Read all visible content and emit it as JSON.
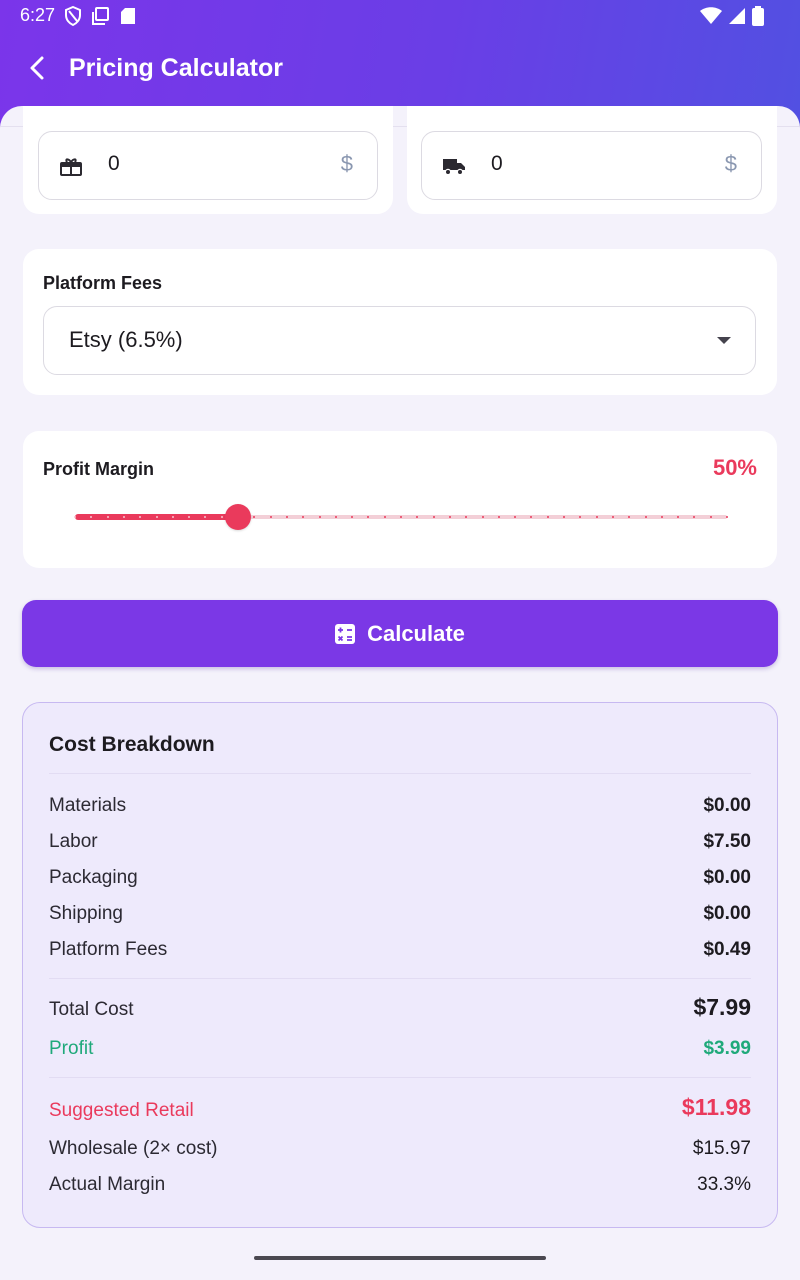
{
  "status_bar": {
    "time": "6:27"
  },
  "app_bar": {
    "title": "Pricing Calculator"
  },
  "cost_inputs": {
    "packaging": {
      "icon": "gift-box-icon",
      "value": "0",
      "suffix": "$"
    },
    "shipping": {
      "icon": "truck-icon",
      "value": "0",
      "suffix": "$"
    }
  },
  "platform_fees": {
    "label": "Platform Fees",
    "selected": "Etsy (6.5%)"
  },
  "profit_margin": {
    "label": "Profit Margin",
    "value_text": "50%",
    "fraction": 0.25,
    "divisions": 40
  },
  "calculate_button": {
    "label": "Calculate",
    "icon": "calculator-icon"
  },
  "breakdown": {
    "title": "Cost Breakdown",
    "items": [
      {
        "label": "Materials",
        "value": "$0.00"
      },
      {
        "label": "Labor",
        "value": "$7.50"
      },
      {
        "label": "Packaging",
        "value": "$0.00"
      },
      {
        "label": "Shipping",
        "value": "$0.00"
      },
      {
        "label": "Platform Fees",
        "value": "$0.49"
      }
    ],
    "total_cost": {
      "label": "Total Cost",
      "value": "$7.99"
    },
    "profit": {
      "label": "Profit",
      "value": "$3.99"
    },
    "suggested_retail": {
      "label": "Suggested Retail",
      "value": "$11.98"
    },
    "wholesale": {
      "label": "Wholesale (2× cost)",
      "value": "$15.97"
    },
    "actual_margin": {
      "label": "Actual Margin",
      "value": "33.3%"
    }
  },
  "colors": {
    "primary": "#7b38e6",
    "accent_red": "#ea3a5c",
    "profit_green": "#1fa97a",
    "background": "#f4f2fb"
  }
}
